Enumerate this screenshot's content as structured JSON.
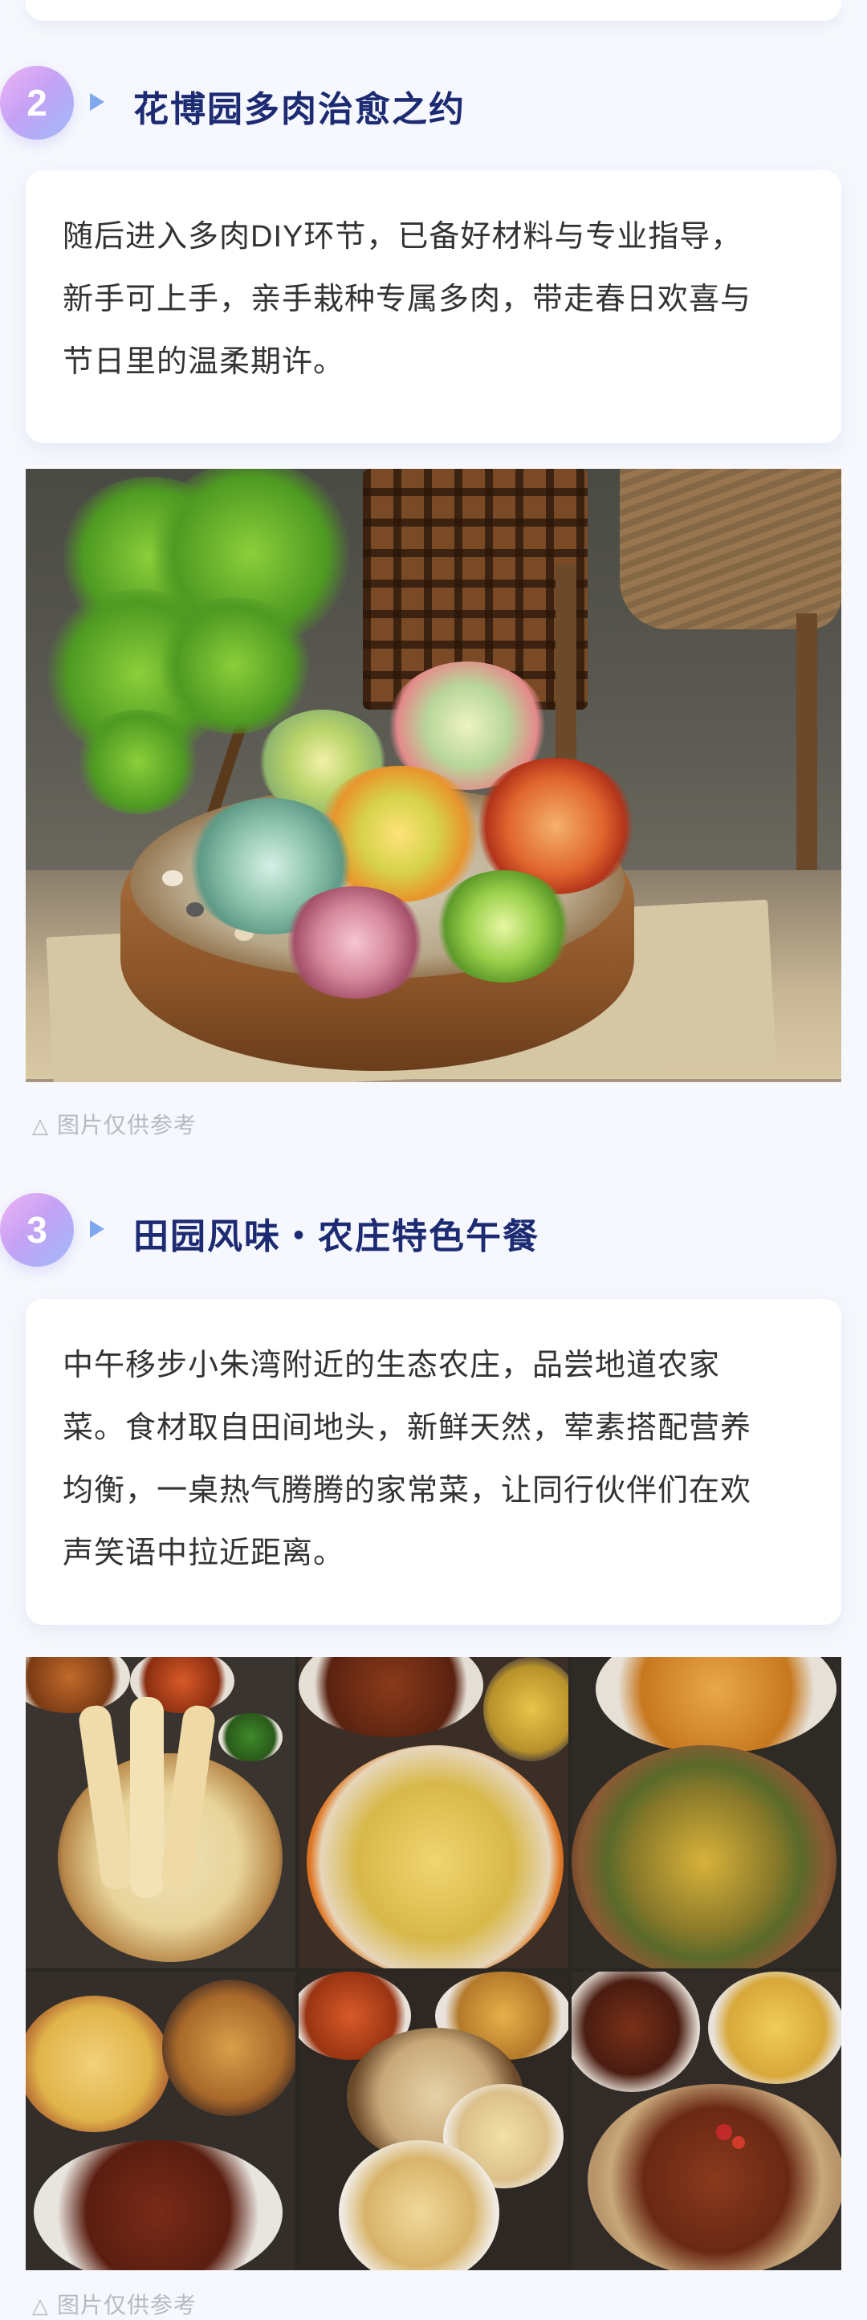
{
  "sections": [
    {
      "number": "2",
      "title": "花博园多肉治愈之约",
      "paragraph_lines": [
        "随后进入多肉DIY环节，已备好材料与专业指导，",
        "新手可上手，亲手栽种专属多肉，带走春日欢喜与",
        "节日里的温柔期许。"
      ],
      "caption": "图片仅供参考"
    },
    {
      "number": "3",
      "title": "田园风味・农庄特色午餐",
      "paragraph_lines": [
        "中午移步小朱湾附近的生态农庄，品尝地道农家",
        "菜。食材取自田间地头，新鲜天然，荤素搭配营养",
        "均衡，一桌热气腾腾的家常菜，让同行伙伴们在欢",
        "声笑语中拉近距离。"
      ],
      "caption": "图片仅供参考"
    }
  ],
  "icons": {
    "play": "play-triangle-icon",
    "caption": "warning-triangle-outline-icon"
  },
  "colors": {
    "title": "#1d2b73",
    "badge_gradient": [
      "#f0b3f4",
      "#9fbaf8"
    ],
    "play_icon": "#7fa8f0",
    "caption": "#b8b8c4",
    "page_bg": "#f6f8fd",
    "card_bg": "#ffffff"
  }
}
